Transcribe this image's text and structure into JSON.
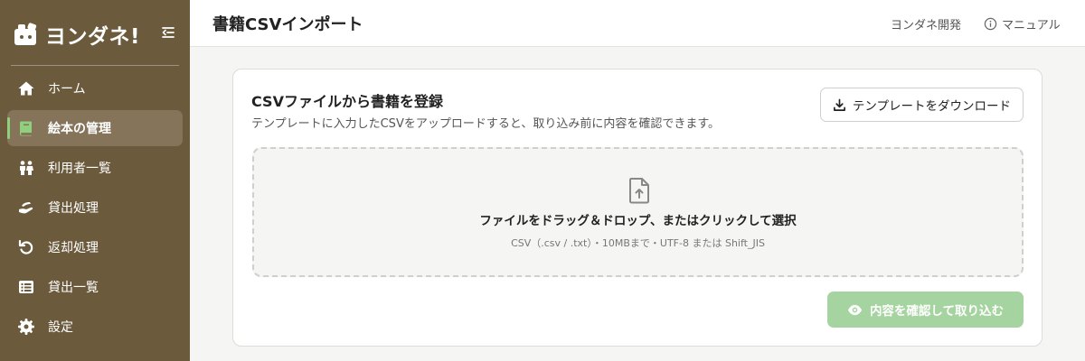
{
  "brand": {
    "name": "ヨンダネ!",
    "logo_icon": "book-mascot-icon"
  },
  "sidebar": {
    "collapse_icon": "collapse-sidebar-icon",
    "items": [
      {
        "label": "ホーム",
        "icon": "home-icon",
        "active": false
      },
      {
        "label": "絵本の管理",
        "icon": "book-icon",
        "active": true
      },
      {
        "label": "利用者一覧",
        "icon": "users-icon",
        "active": false
      },
      {
        "label": "貸出処理",
        "icon": "handover-icon",
        "active": false
      },
      {
        "label": "返却処理",
        "icon": "return-icon",
        "active": false
      },
      {
        "label": "貸出一覧",
        "icon": "list-icon",
        "active": false
      },
      {
        "label": "設定",
        "icon": "gear-icon",
        "active": false
      }
    ]
  },
  "header": {
    "title": "書籍CSVインポート",
    "dev_link": "ヨンダネ開発",
    "manual_link": "マニュアル"
  },
  "card": {
    "title": "CSVファイルから書籍を登録",
    "description": "テンプレートに入力したCSVをアップロードすると、取り込み前に内容を確認できます。",
    "template_button": "テンプレートをダウンロード",
    "dropzone": {
      "main_text": "ファイルをドラッグ＆ドロップ、またはクリックして選択",
      "sub_text": "CSV（.csv / .txt）・10MBまで・UTF-8 または Shift_JIS"
    },
    "import_button": "内容を確認して取り込む",
    "import_button_disabled": true
  },
  "colors": {
    "sidebar_bg": "#6b5a3c",
    "sidebar_active_bg": "#85745a",
    "active_indicator": "#8fd07f",
    "import_button_bg": "#a6d4a0",
    "page_bg": "#f5f5f3"
  }
}
